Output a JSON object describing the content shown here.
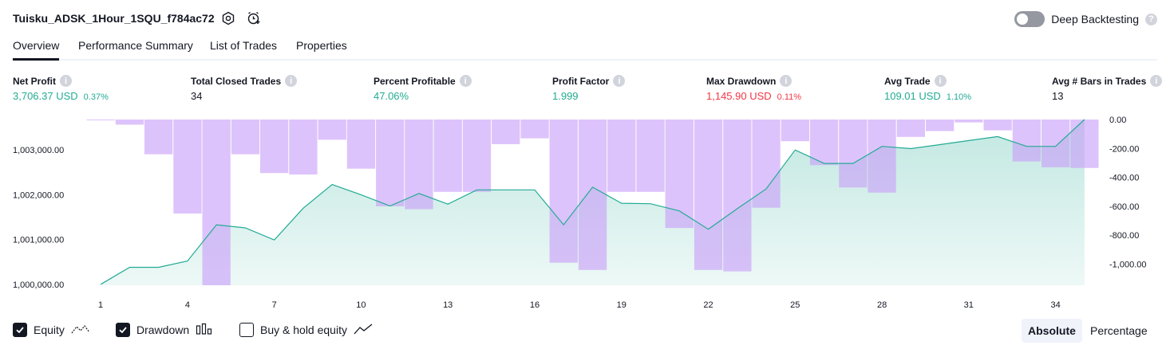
{
  "header": {
    "title": "Tuisku_ADSK_1Hour_1SQU_f784ac72",
    "deep_backtesting_label": "Deep Backtesting",
    "help_glyph": "?"
  },
  "tabs": [
    {
      "label": "Overview",
      "active": true
    },
    {
      "label": "Performance Summary",
      "active": false
    },
    {
      "label": "List of Trades",
      "active": false
    },
    {
      "label": "Properties",
      "active": false
    }
  ],
  "metrics": [
    {
      "label": "Net Profit",
      "value": "3,706.37 USD",
      "pct": "0.37%",
      "color": "green"
    },
    {
      "label": "Total Closed Trades",
      "value": "34",
      "pct": "",
      "color": "dark"
    },
    {
      "label": "Percent Profitable",
      "value": "47.06%",
      "pct": "",
      "color": "green"
    },
    {
      "label": "Profit Factor",
      "value": "1.999",
      "pct": "",
      "color": "green"
    },
    {
      "label": "Max Drawdown",
      "value": "1,145.90 USD",
      "pct": "0.11%",
      "color": "red"
    },
    {
      "label": "Avg Trade",
      "value": "109.01 USD",
      "pct": "1.10%",
      "color": "green"
    },
    {
      "label": "Avg # Bars in Trades",
      "value": "13",
      "pct": "",
      "color": "dark"
    }
  ],
  "legend": {
    "equity": {
      "label": "Equity",
      "checked": true,
      "icon": "equity-line-icon"
    },
    "drawdown": {
      "label": "Drawdown",
      "checked": true,
      "icon": "drawdown-bars-icon"
    },
    "buyhold": {
      "label": "Buy & hold equity",
      "checked": false,
      "icon": "buyhold-line-icon"
    }
  },
  "scale_toggle": {
    "absolute": "Absolute",
    "percentage": "Percentage",
    "selected": "Absolute"
  },
  "colors": {
    "equity_line": "#22ab94",
    "equity_fill": "#22ab94",
    "drawdown_bar": "#c89ef8",
    "profit_green": "#22ab94",
    "loss_red": "#f23645"
  },
  "chart_data": {
    "type": "area",
    "x_ticks": [
      "1",
      "4",
      "7",
      "10",
      "13",
      "16",
      "19",
      "22",
      "25",
      "28",
      "31",
      "34"
    ],
    "left_axis_ticks": [
      "1,000,000.00",
      "1,001,000.00",
      "1,002,000.00",
      "1,003,000.00"
    ],
    "right_axis_ticks": [
      "0.00",
      "-200.00",
      "-400.00",
      "-600.00",
      "-800.00",
      "-1,000.00"
    ],
    "left_ylim": [
      999980,
      1003680
    ],
    "right_ylim": [
      -1145.9,
      0
    ],
    "series": [
      {
        "name": "Equity",
        "x": [
          1,
          2,
          3,
          4,
          5,
          6,
          7,
          8,
          9,
          10,
          11,
          12,
          13,
          14,
          15,
          16,
          17,
          18,
          19,
          20,
          21,
          22,
          23,
          24,
          25,
          26,
          27,
          28,
          29,
          30,
          31,
          32,
          33,
          34,
          35
        ],
        "values": [
          1000000,
          1000380,
          1000380,
          1000520,
          1001330,
          1001260,
          1000990,
          1001700,
          1002230,
          1002000,
          1001750,
          1002030,
          1001790,
          1002110,
          1002110,
          1002110,
          1001330,
          1002170,
          1001810,
          1001800,
          1001640,
          1001230,
          1001690,
          1002130,
          1003000,
          1002700,
          1002700,
          1003080,
          1003030,
          1003120,
          1003210,
          1003300,
          1003080,
          1003080,
          1003680
        ]
      },
      {
        "name": "Drawdown",
        "x": [
          1,
          2,
          3,
          4,
          5,
          6,
          7,
          8,
          9,
          10,
          11,
          12,
          13,
          14,
          15,
          16,
          17,
          18,
          19,
          20,
          21,
          22,
          23,
          24,
          25,
          26,
          27,
          28,
          29,
          30,
          31,
          32,
          33,
          34,
          35
        ],
        "values": [
          -5,
          -35,
          -240,
          -650,
          -1145.9,
          -240,
          -370,
          -380,
          -140,
          -340,
          -600,
          -620,
          -500,
          -500,
          -170,
          -130,
          -990,
          -1040,
          -500,
          -500,
          -750,
          -1040,
          -1050,
          -610,
          -150,
          -315,
          -470,
          -505,
          -120,
          -80,
          -20,
          -75,
          -290,
          -330,
          -335
        ]
      }
    ]
  }
}
